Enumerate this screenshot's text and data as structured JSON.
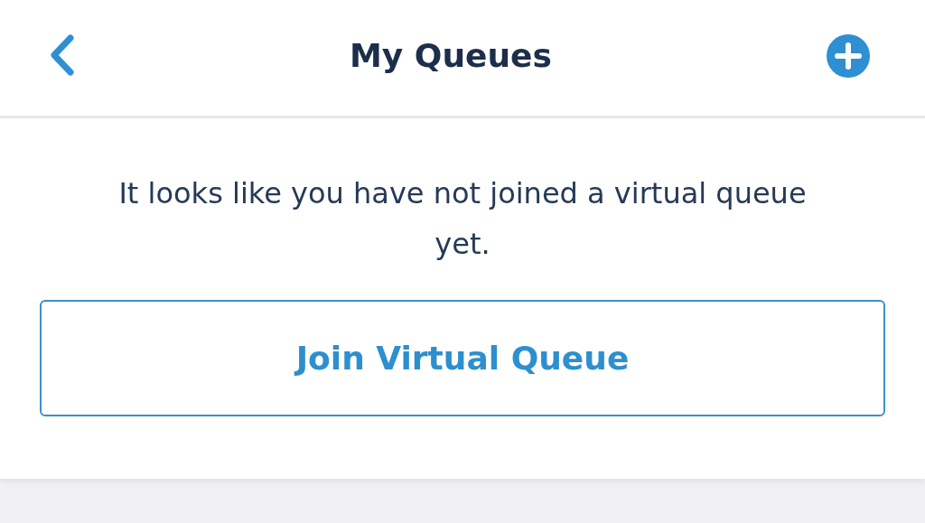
{
  "header": {
    "title": "My Queues"
  },
  "message": "It looks like you have not joined a virtual queue yet.",
  "buttons": [
    {
      "label": "Join Virtual Queue"
    }
  ]
}
